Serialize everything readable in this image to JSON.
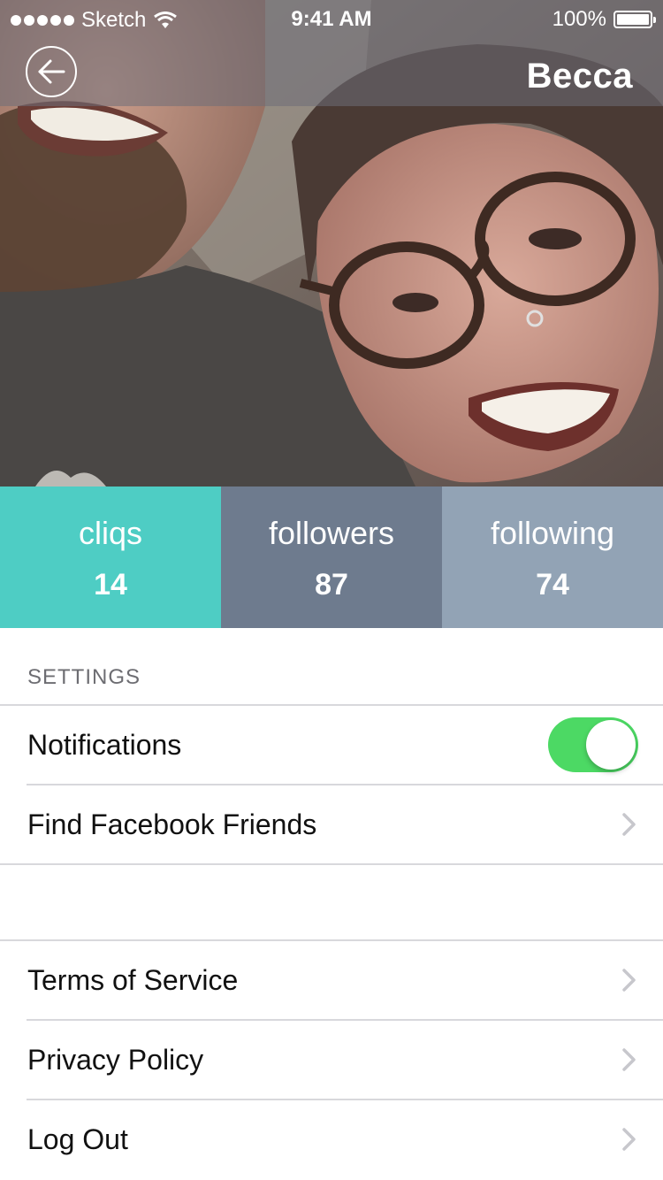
{
  "status_bar": {
    "carrier": "Sketch",
    "time": "9:41 AM",
    "battery": "100%"
  },
  "header": {
    "title": "Becca",
    "back_icon": "back-arrow-circle-icon"
  },
  "stats": [
    {
      "label": "cliqs",
      "value": "14",
      "color": "#4ecdc4"
    },
    {
      "label": "followers",
      "value": "87",
      "color": "#6e7b8e"
    },
    {
      "label": "following",
      "value": "74",
      "color": "#92a3b5"
    }
  ],
  "settings": {
    "section_title": "SETTINGS",
    "notifications": {
      "label": "Notifications",
      "enabled": true,
      "toggle_color": "#4cd964"
    },
    "find_friends": {
      "label": "Find Facebook Friends"
    }
  },
  "links": {
    "terms": "Terms of Service",
    "privacy": "Privacy Policy",
    "logout": "Log Out"
  }
}
